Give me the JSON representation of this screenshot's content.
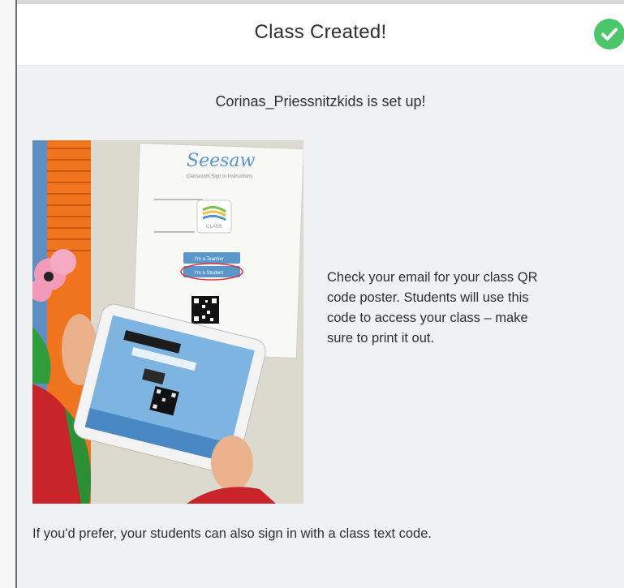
{
  "dialog": {
    "title": "Class Created!",
    "subtitle": "Corinas_Priessnitzkids is set up!",
    "instructions": "Check your email for your class QR code poster. Students will use this code to access your class – make sure to print it out.",
    "footer": "If you'd prefer, your students can also sign in with a class text code."
  },
  "poster": {
    "brand": "Seesaw",
    "subtitle": "Classroom Sign In Instructions",
    "class_label": "CLASS",
    "teacher_button": "I'm a Teacher",
    "student_button": "I'm a Student"
  },
  "icons": {
    "status": "checkmark-icon"
  },
  "colors": {
    "success": "#4cc66b",
    "seesaw_blue": "#5a96c8",
    "background": "#eff1f3"
  }
}
